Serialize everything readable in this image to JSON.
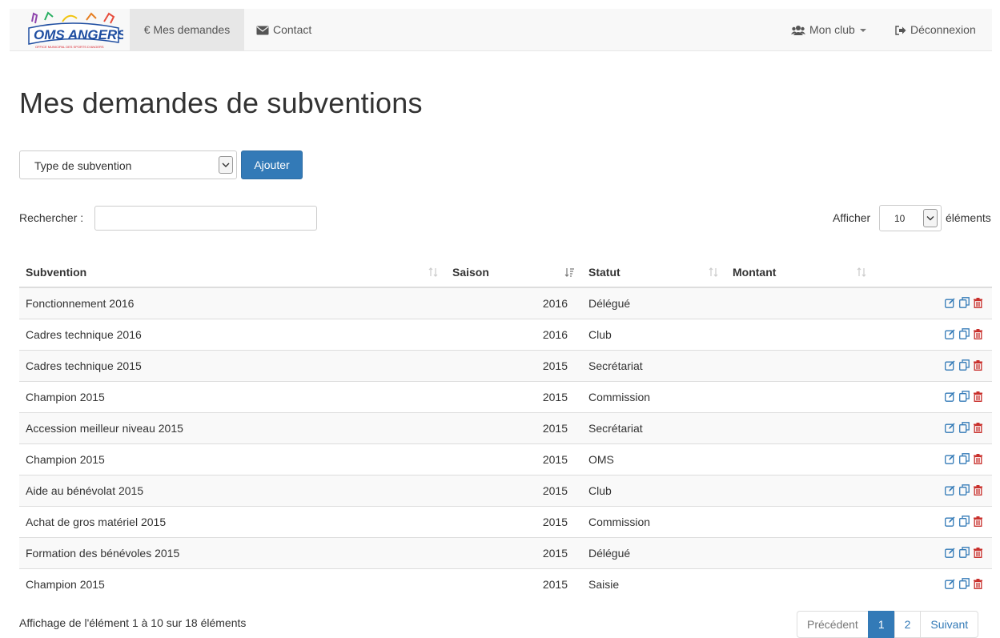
{
  "nav": {
    "logo_text": "OMS ANGERS",
    "logo_subtext": "OFFICE MUNICIPAL DES SPORTS D'ANGERS",
    "demandes_label": "€ Mes demandes",
    "contact_label": "Contact",
    "club_label": "Mon club",
    "logout_label": "Déconnexion"
  },
  "page": {
    "title": "Mes demandes de subventions"
  },
  "toolbar": {
    "type_select_value": "Type de subvention",
    "add_label": "Ajouter"
  },
  "filters": {
    "search_label": "Rechercher :",
    "search_value": "",
    "length_prefix": "Afficher",
    "length_value": "10",
    "length_suffix": "éléments"
  },
  "table": {
    "headers": [
      "Subvention",
      "Saison",
      "Statut",
      "Montant"
    ],
    "rows": [
      {
        "subvention": "Fonctionnement 2016",
        "saison": "2016",
        "statut": "Délégué",
        "montant": ""
      },
      {
        "subvention": "Cadres technique 2016",
        "saison": "2016",
        "statut": "Club",
        "montant": ""
      },
      {
        "subvention": "Cadres technique 2015",
        "saison": "2015",
        "statut": "Secrétariat",
        "montant": ""
      },
      {
        "subvention": "Champion 2015",
        "saison": "2015",
        "statut": "Commission",
        "montant": ""
      },
      {
        "subvention": "Accession meilleur niveau 2015",
        "saison": "2015",
        "statut": "Secrétariat",
        "montant": ""
      },
      {
        "subvention": "Champion 2015",
        "saison": "2015",
        "statut": "OMS",
        "montant": ""
      },
      {
        "subvention": "Aide au bénévolat 2015",
        "saison": "2015",
        "statut": "Club",
        "montant": ""
      },
      {
        "subvention": "Achat de gros matériel 2015",
        "saison": "2015",
        "statut": "Commission",
        "montant": ""
      },
      {
        "subvention": "Formation des bénévoles 2015",
        "saison": "2015",
        "statut": "Délégué",
        "montant": ""
      },
      {
        "subvention": "Champion 2015",
        "saison": "2015",
        "statut": "Saisie",
        "montant": ""
      }
    ]
  },
  "footer": {
    "info": "Affichage de l'élément 1 à 10 sur 18 éléments",
    "prev_label": "Précédent",
    "pages": [
      "1",
      "2"
    ],
    "active_page": "1",
    "next_label": "Suivant"
  },
  "colors": {
    "primary": "#337ab7",
    "delete": "#c9302c",
    "logo_blue": "#1f4ea1",
    "logo_red": "#d9232d"
  },
  "icons": {
    "row_actions": [
      "edit-icon",
      "copy-icon",
      "trash-icon"
    ],
    "nav": [
      "envelope-icon",
      "users-icon",
      "sign-out-icon"
    ]
  }
}
